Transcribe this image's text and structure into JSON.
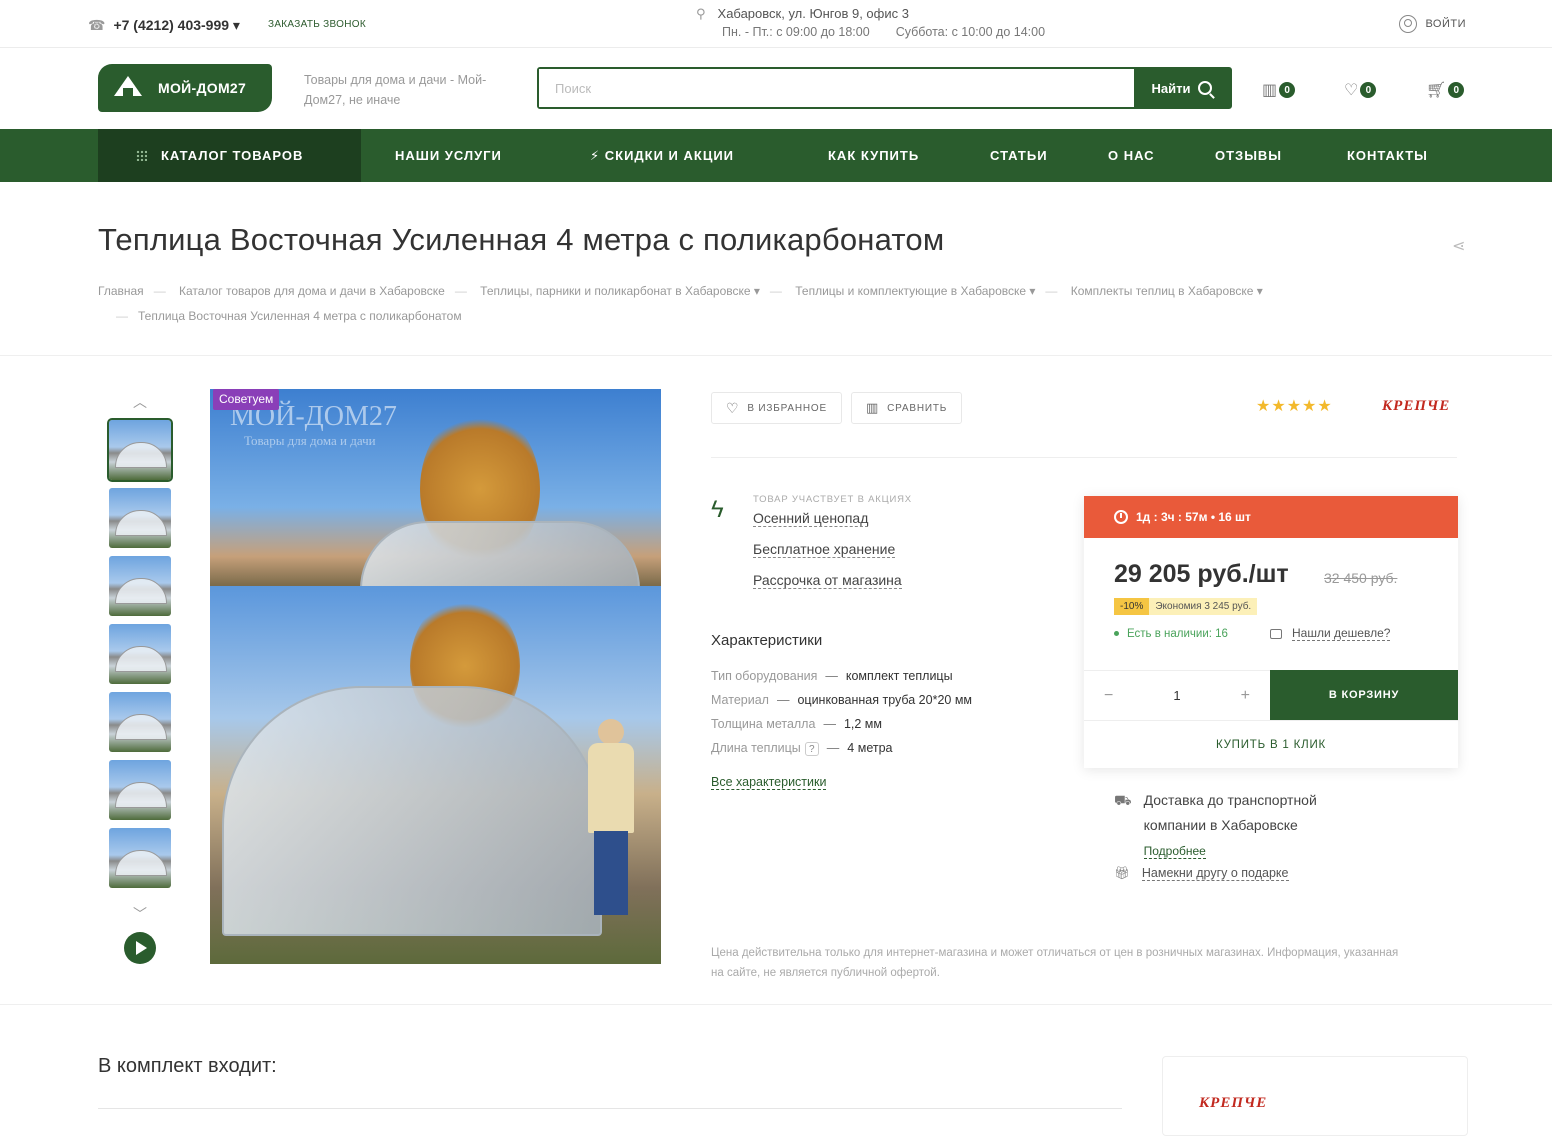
{
  "topbar": {
    "phone": "+7 (4212) 403-999",
    "callback": "ЗАКАЗАТЬ ЗВОНОК",
    "address": "Хабаровск, ул. Юнгов 9, офис 3",
    "hours_weekday": "Пн. - Пт.: с 09:00 до 18:00",
    "hours_saturday": "Суббота: с 10:00 до 14:00",
    "login": "ВОЙТИ"
  },
  "header": {
    "logo_text": "МОЙ-ДОМ27",
    "slogan": "Товары для дома и дачи - Мой-Дом27, не иначе",
    "search_placeholder": "Поиск",
    "search_button": "Найти",
    "compare_count": "0",
    "favorites_count": "0",
    "cart_count": "0"
  },
  "nav": {
    "catalog": "КАТАЛОГ ТОВАРОВ",
    "items": [
      "НАШИ УСЛУГИ",
      "⚡ СКИДКИ И АКЦИИ",
      "КАК КУПИТЬ",
      "СТАТЬИ",
      "О НАС",
      "ОТЗЫВЫ",
      "КОНТАКТЫ"
    ]
  },
  "page": {
    "title": "Теплица Восточная Усиленная 4 метра с поликарбонатом",
    "breadcrumbs": [
      "Главная",
      "Каталог товаров для дома и дачи в Хабаровске",
      "Теплицы, парники и поликарбонат в Хабаровске",
      "Теплицы и комплектующие в Хабаровске",
      "Комплекты теплиц в Хабаровске",
      "Теплица Восточная Усиленная 4 метра с поликарбонатом"
    ]
  },
  "gallery": {
    "sticker": "Советуем",
    "watermark": "МОЙ-ДОМ27",
    "watermark_sub": "Товары для дома и дачи"
  },
  "product": {
    "favorite_label": "В ИЗБРАННОЕ",
    "compare_label": "СРАВНИТЬ",
    "rating": 5,
    "brand": "КРЕПЧЕ",
    "promo_title": "ТОВАР УЧАСТВУЕТ В АКЦИЯХ",
    "promos": [
      "Осенний ценопад",
      "Бесплатное хранение",
      "Рассрочка от магазина"
    ],
    "chars_title": "Характеристики",
    "chars": [
      {
        "name": "Тип оборудования",
        "value": "комплект теплицы"
      },
      {
        "name": "Материал",
        "value": "оцинкованная труба 20*20 мм"
      },
      {
        "name": "Толщина металла",
        "value": "1,2 мм"
      },
      {
        "name": "Длина теплицы",
        "value": "4 метра"
      }
    ],
    "all_chars": "Все характеристики",
    "disclaimer": "Цена действительна только для интернет-магазина и может отличаться от цен в розничных магазинах. Информация, указанная на сайте, не является публичной офертой."
  },
  "buy": {
    "timer": "1д : 3ч : 57м  •  16 шт",
    "price": "29 205 руб./шт",
    "old_price": "32 450 руб.",
    "discount_pct": "-10%",
    "economy": "Экономия 3 245 руб.",
    "stock": "Есть в наличии: 16",
    "cheaper": "Нашли дешевле?",
    "qty": "1",
    "to_cart": "В КОРЗИНУ",
    "one_click": "КУПИТЬ В 1 КЛИК",
    "delivery_line1": "Доставка до транспортной",
    "delivery_line2": "компании в Хабаровске",
    "delivery_more": "Подробнее",
    "gift": "Намекни другу о подарке"
  },
  "kit": {
    "title": "В комплект входит:"
  }
}
